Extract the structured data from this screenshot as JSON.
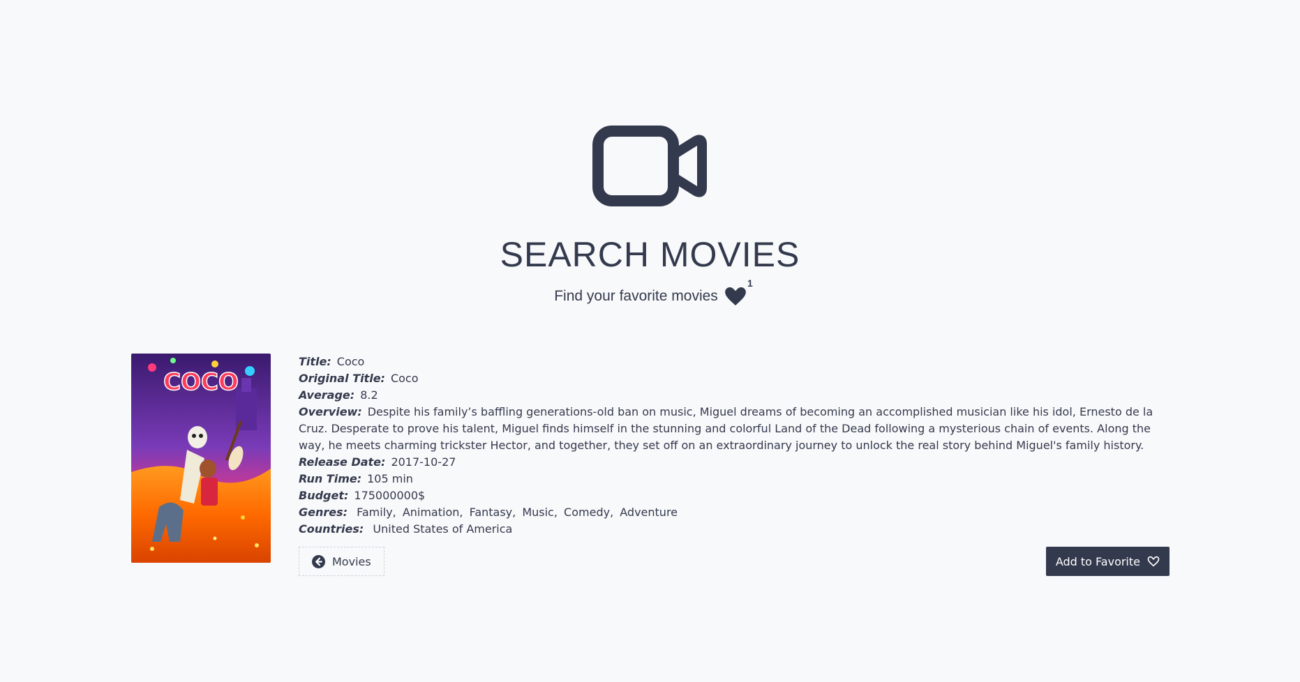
{
  "header": {
    "title": "SEARCH MOVIES",
    "subtitle": "Find your favorite movies",
    "favorites_count": "1",
    "icon": "video-camera-icon"
  },
  "movie": {
    "poster": {
      "alt_icon": "movie-poster-image",
      "caption": "COCO"
    },
    "title_label": "Title:",
    "title": "Coco",
    "original_title_label": "Original Title:",
    "original_title": "Coco",
    "average_label": "Average:",
    "average": "8.2",
    "overview_label": "Overview:",
    "overview": "Despite his family’s baffling generations-old ban on music, Miguel dreams of becoming an accomplished musician like his idol, Ernesto de la Cruz. Desperate to prove his talent, Miguel finds himself in the stunning and colorful Land of the Dead following a mysterious chain of events. Along the way, he meets charming trickster Hector, and together, they set off on an extraordinary journey to unlock the real story behind Miguel's family history.",
    "release_date_label": "Release Date:",
    "release_date": "2017-10-27",
    "run_time_label": "Run Time:",
    "run_time": "105 min",
    "budget_label": "Budget:",
    "budget": "175000000$",
    "genres_label": "Genres:",
    "genres": [
      "Family",
      "Animation",
      "Fantasy",
      "Music",
      "Comedy",
      "Adventure"
    ],
    "countries_label": "Countries:",
    "countries": "United States of America"
  },
  "actions": {
    "back_label": "Movies",
    "back_icon": "arrow-circle-left-icon",
    "favorite_label": "Add to Favorite",
    "favorite_icon": "heart-outline-icon"
  },
  "colors": {
    "background": "#f8f9fa",
    "primary": "#343a4e",
    "button_text": "#ffffff"
  }
}
